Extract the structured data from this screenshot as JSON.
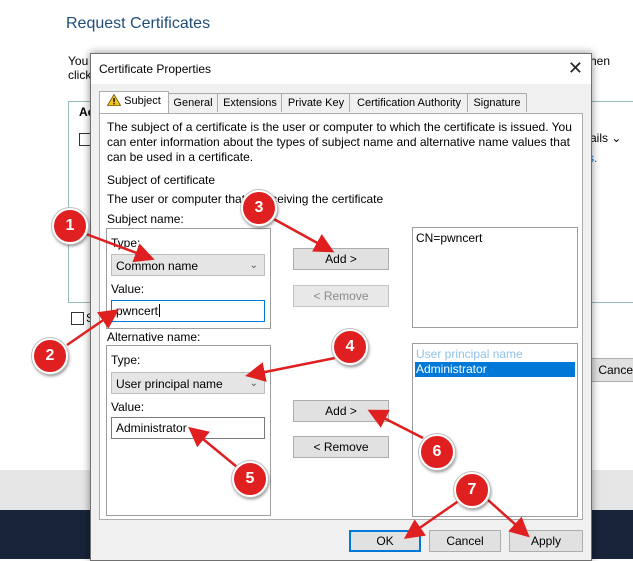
{
  "background": {
    "title": "Request Certificates",
    "intro_line1": "You",
    "intro_line2": "click",
    "intro_right": "hen",
    "table_header": "Ac",
    "details": "ails",
    "link_suffix": "s.",
    "check_label": "S",
    "cancel_label": "Cancel"
  },
  "dialog": {
    "title": "Certificate Properties",
    "tabs": [
      {
        "label": "Subject",
        "active": true
      },
      {
        "label": "General"
      },
      {
        "label": "Extensions"
      },
      {
        "label": "Private Key"
      },
      {
        "label": "Certification Authority"
      },
      {
        "label": "Signature"
      }
    ],
    "description": "The subject of a certificate is the user or computer to which the certificate is issued. You can enter information about the types of subject name and alternative name values that can be used in a certificate.",
    "subject_heading": "Subject of certificate",
    "subject_sub": "The user or computer that is receiving the certificate",
    "subject_name": {
      "label": "Subject name:",
      "type_label": "Type:",
      "type_value": "Common name",
      "value_label": "Value:",
      "value": "pwncert"
    },
    "alt_name": {
      "label": "Alternative name:",
      "type_label": "Type:",
      "type_value": "User principal name",
      "value_label": "Value:",
      "value": "Administrator"
    },
    "add_label": "Add >",
    "remove_label": "< Remove",
    "subject_list": [
      "CN=pwncert"
    ],
    "alt_list": {
      "header": "User principal name",
      "selected": "Administrator"
    },
    "ok_label": "OK",
    "cancel_label": "Cancel",
    "apply_label": "Apply"
  },
  "annotations": [
    "1",
    "2",
    "3",
    "4",
    "5",
    "6",
    "7"
  ],
  "colors": {
    "accent": "#0078d7",
    "marker": "#e02020",
    "arrow": "#e02020",
    "taskbar": "#17243a"
  }
}
